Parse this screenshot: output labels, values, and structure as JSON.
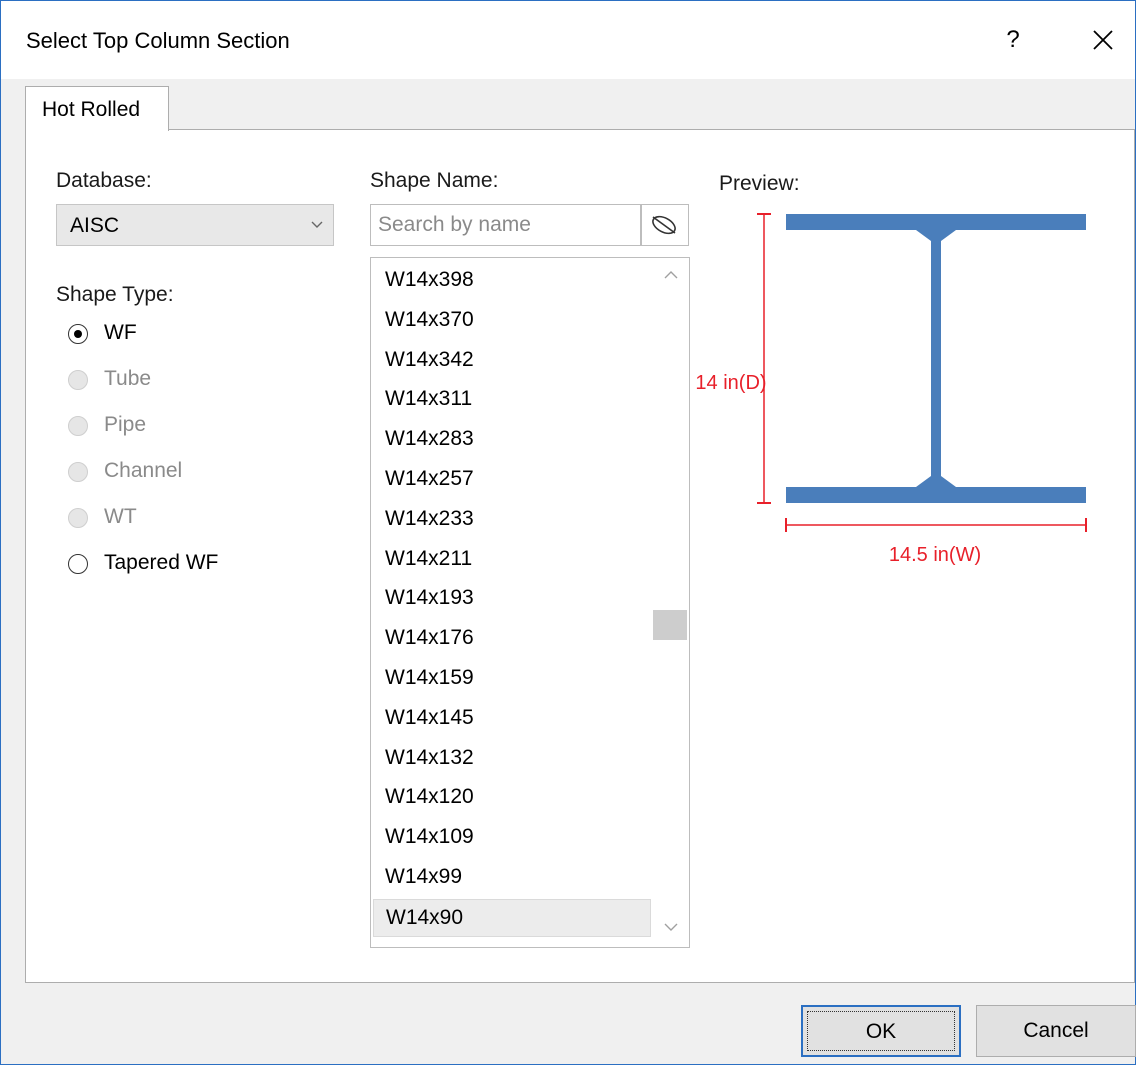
{
  "dialog": {
    "title": "Select  Top Column Section",
    "help_glyph": "?",
    "close_glyph": "✕"
  },
  "tabs": [
    {
      "label": "Hot Rolled",
      "active": true
    }
  ],
  "database": {
    "label": "Database:",
    "value": "AISC"
  },
  "shape_type": {
    "label": "Shape Type:",
    "options": [
      {
        "label": "WF",
        "checked": true,
        "enabled": true
      },
      {
        "label": "Tube",
        "checked": false,
        "enabled": false
      },
      {
        "label": "Pipe",
        "checked": false,
        "enabled": false
      },
      {
        "label": "Channel",
        "checked": false,
        "enabled": false
      },
      {
        "label": "WT",
        "checked": false,
        "enabled": false
      },
      {
        "label": "Tapered WF",
        "checked": false,
        "enabled": true
      }
    ]
  },
  "shape_name": {
    "label": "Shape Name:",
    "search_placeholder": "Search by name",
    "items": [
      "W14x398",
      "W14x370",
      "W14x342",
      "W14x311",
      "W14x283",
      "W14x257",
      "W14x233",
      "W14x211",
      "W14x193",
      "W14x176",
      "W14x159",
      "W14x145",
      "W14x132",
      "W14x120",
      "W14x109",
      "W14x99",
      "W14x90"
    ],
    "selected": "W14x90"
  },
  "preview": {
    "label": "Preview:",
    "depth_label": "14 in(D)",
    "width_label": "14.5 in(W)",
    "section_color": "#4a7ebb",
    "dimension_color": "#e8202a"
  },
  "buttons": {
    "ok": "OK",
    "cancel": "Cancel"
  },
  "colors": {
    "accent": "#2b6fc2"
  }
}
